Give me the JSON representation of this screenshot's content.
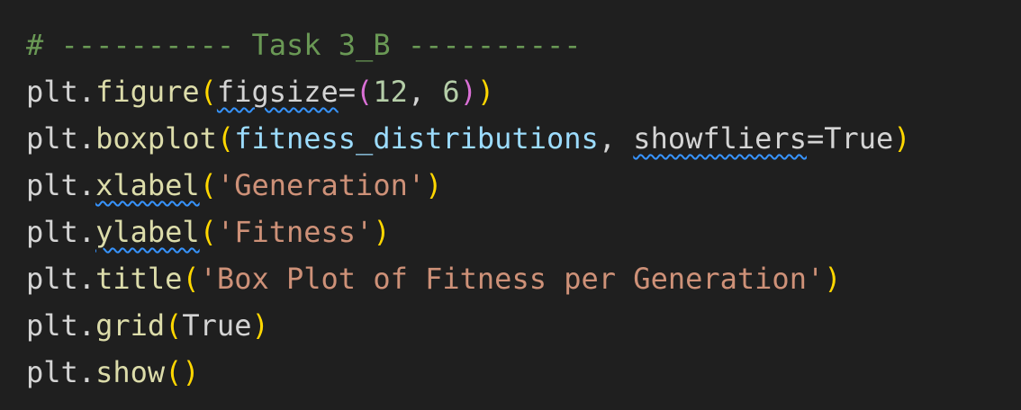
{
  "editor": {
    "comment": "# ---------- Task 3_B ----------",
    "obj": "plt",
    "dot": ".",
    "comma_space": ", ",
    "eq": "=",
    "paren_open": "(",
    "paren_close": ")",
    "lines": {
      "figure": {
        "fn": "figure",
        "kw": "figsize",
        "num1": "12",
        "num2": "6"
      },
      "boxplot": {
        "fn": "boxplot",
        "arg": "fitness_distributions",
        "kw": "showfliers",
        "val": "True"
      },
      "xlabel": {
        "fn": "xlabel",
        "arg": "'Generation'"
      },
      "ylabel": {
        "fn": "ylabel",
        "arg": "'Fitness'"
      },
      "title": {
        "fn": "title",
        "arg": "'Box Plot of Fitness per Generation'"
      },
      "grid": {
        "fn": "grid",
        "arg": "True"
      },
      "show": {
        "fn": "show"
      }
    }
  },
  "colors": {
    "background": "#1f1f1f",
    "text": "#d4d4d4",
    "comment": "#6a9955",
    "function": "#dcdcaa",
    "variable": "#9cdcfe",
    "string": "#ce9178",
    "number": "#b5cea8",
    "bracket_level1": "#ffd700",
    "bracket_level2": "#da70d6",
    "squiggle": "#3794ff"
  }
}
